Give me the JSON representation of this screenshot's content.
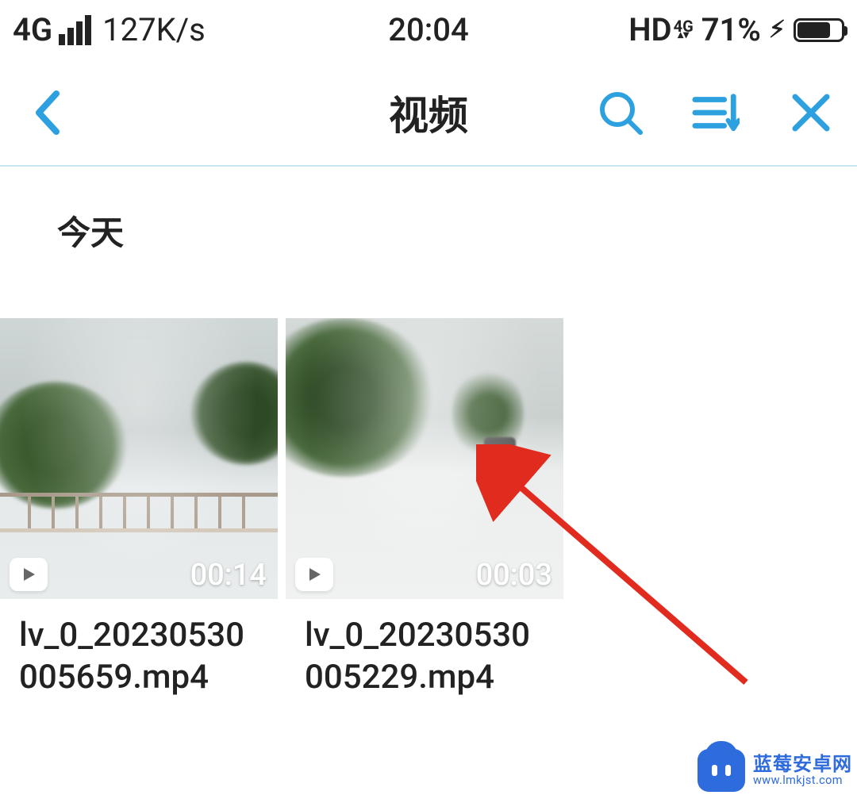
{
  "status": {
    "network_type": "4G",
    "speed": "127K/s",
    "time": "20:04",
    "hd": "HD",
    "secondary_network": "4G",
    "battery_percent": "71%"
  },
  "header": {
    "title": "视频"
  },
  "section": {
    "label": "今天"
  },
  "videos": [
    {
      "duration": "00:14",
      "filename": "lv_0_20230530005659.mp4"
    },
    {
      "duration": "00:03",
      "filename": "lv_0_20230530005229.mp4"
    }
  ],
  "watermark": {
    "title": "蓝莓安卓网",
    "url": "www.lmkjst.com"
  },
  "colors": {
    "accent": "#2da0e0",
    "annotation": "#e22b1f",
    "brand": "#2e6bdc"
  }
}
